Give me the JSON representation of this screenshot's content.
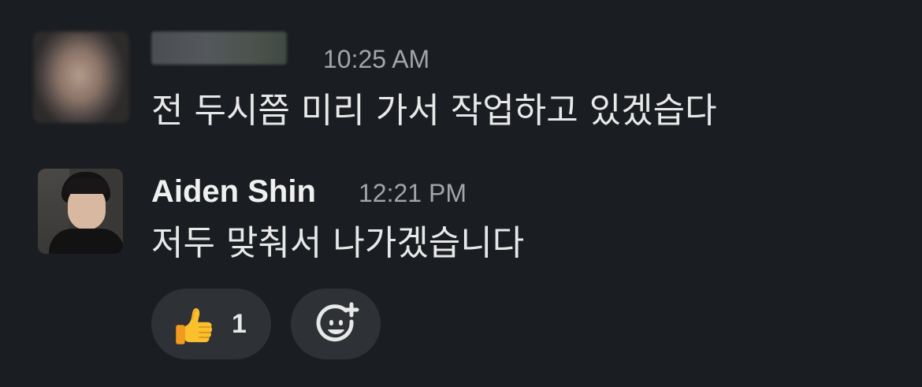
{
  "messages": [
    {
      "sender": "",
      "time": "10:25 AM",
      "text": "전 두시쯤 미리 가서 작업하고 있겠습다",
      "avatar": "blurred-avatar"
    },
    {
      "sender": "Aiden Shin",
      "time": "12:21 PM",
      "text": "저두 맞춰서 나가겠습니다",
      "avatar": "user-photo"
    }
  ],
  "reactions": [
    {
      "emoji": "thumbs-up-icon",
      "count": "1"
    }
  ],
  "add_reaction": {
    "icon": "add-emoji-icon"
  },
  "colors": {
    "background": "#1a1d21",
    "pill": "#2e3135",
    "text": "#e8e8e8",
    "timestamp": "#a3a5a8",
    "emoji_yellow": "#f7b52c"
  }
}
